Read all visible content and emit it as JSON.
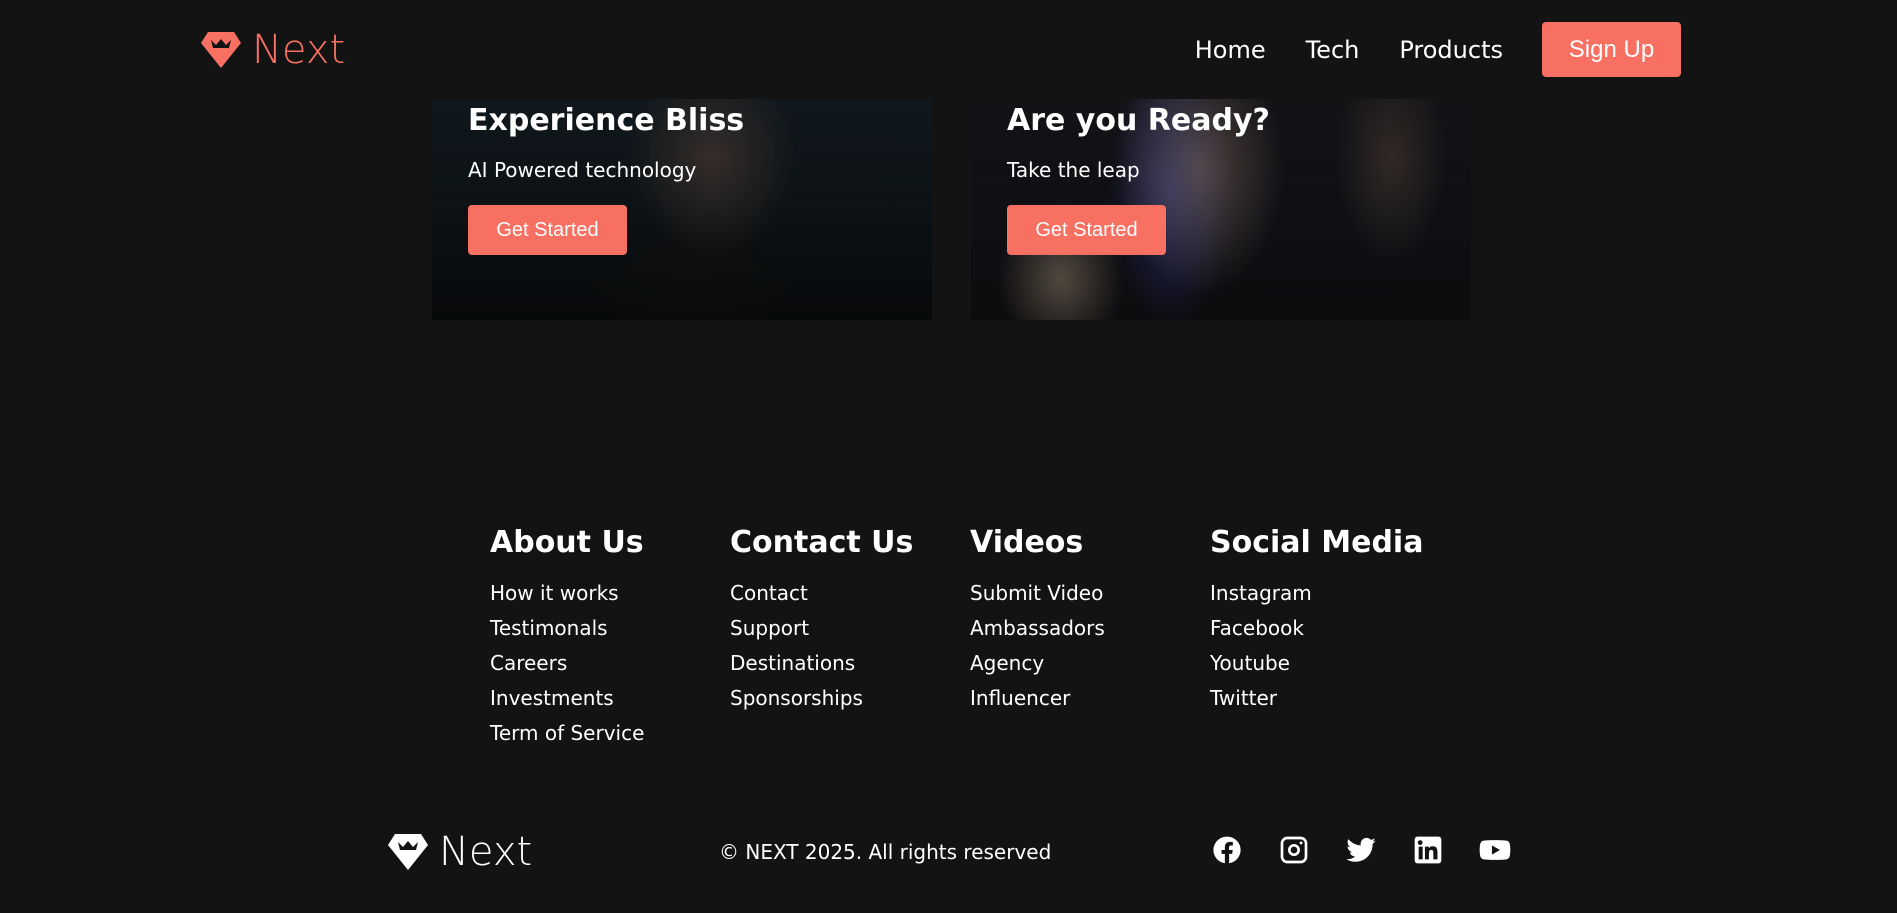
{
  "navbar": {
    "brand": "Next",
    "brand_icon": "diamond-icon",
    "links": [
      "Home",
      "Tech",
      "Products"
    ],
    "signup_label": "Sign Up",
    "accent_color": "#f77062"
  },
  "cards": [
    {
      "title": "Experience Bliss",
      "subtitle": "AI Powered technology",
      "button": "Get Started"
    },
    {
      "title": "Are you Ready?",
      "subtitle": "Take the leap",
      "button": "Get Started"
    }
  ],
  "footer": {
    "columns": [
      {
        "title": "About Us",
        "links": [
          "How it works",
          "Testimonals",
          "Careers",
          "Investments",
          "Term of Service"
        ]
      },
      {
        "title": "Contact Us",
        "links": [
          "Contact",
          "Support",
          "Destinations",
          "Sponsorships"
        ]
      },
      {
        "title": "Videos",
        "links": [
          "Submit Video",
          "Ambassadors",
          "Agency",
          "Influencer"
        ]
      },
      {
        "title": "Social Media",
        "links": [
          "Instagram",
          "Facebook",
          "Youtube",
          "Twitter"
        ]
      }
    ],
    "brand": "Next",
    "copyright": "© NEXT 2025. All rights reserved",
    "social_icons": [
      "facebook-icon",
      "instagram-icon",
      "twitter-icon",
      "linkedin-icon",
      "youtube-icon"
    ]
  }
}
